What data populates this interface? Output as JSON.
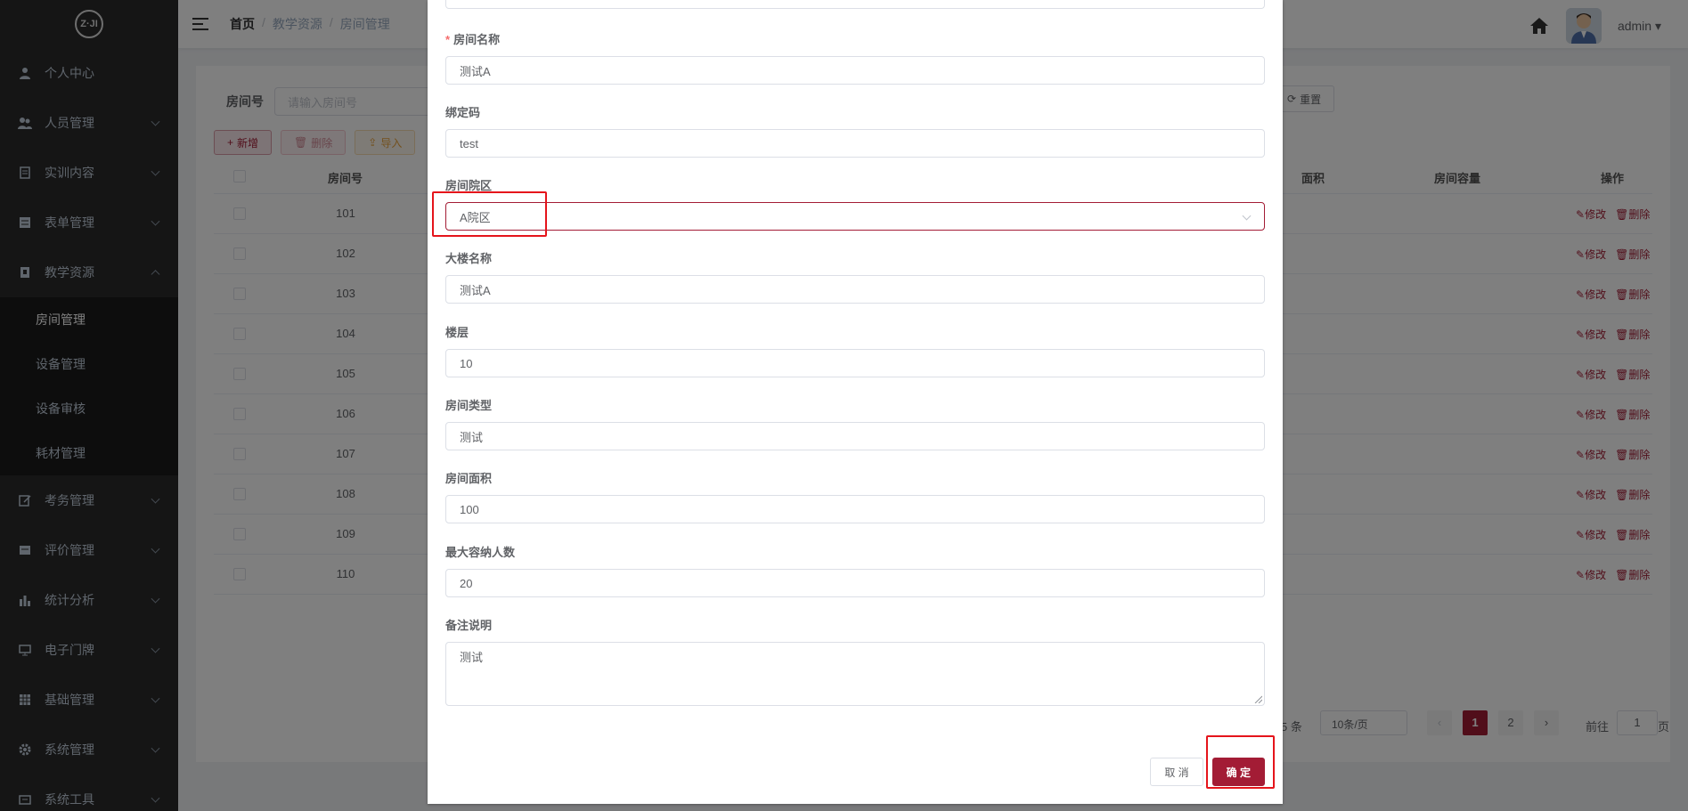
{
  "sidebar": {
    "logo_text": "Z·JI",
    "items": [
      {
        "label": "个人中心",
        "icon": "user-icon"
      },
      {
        "label": "人员管理",
        "icon": "people-icon"
      },
      {
        "label": "实训内容",
        "icon": "doc-icon"
      },
      {
        "label": "表单管理",
        "icon": "form-icon"
      },
      {
        "label": "教学资源",
        "icon": "book-icon"
      }
    ],
    "submenu": [
      {
        "label": "房间管理",
        "active": true
      },
      {
        "label": "设备管理"
      },
      {
        "label": "设备审核"
      },
      {
        "label": "耗材管理"
      }
    ],
    "items_after": [
      {
        "label": "考务管理",
        "icon": "edit-icon"
      },
      {
        "label": "评价管理",
        "icon": "rating-icon"
      },
      {
        "label": "统计分析",
        "icon": "chart-icon"
      },
      {
        "label": "电子门牌",
        "icon": "monitor-icon"
      },
      {
        "label": "基础管理",
        "icon": "grid-icon"
      },
      {
        "label": "系统管理",
        "icon": "gear-icon"
      },
      {
        "label": "系统工具",
        "icon": "tool-icon"
      }
    ]
  },
  "header": {
    "breadcrumb": [
      "首页",
      "教学资源",
      "房间管理"
    ],
    "user": "admin"
  },
  "page": {
    "search_label": "房间号",
    "search_placeholder": "请输入房间号",
    "reset_label": "重置",
    "add_label": "新增",
    "delete_label": "删除",
    "import_label": "导入",
    "columns": {
      "room_no": "房间号",
      "area": "面积",
      "capacity": "房间容量",
      "ops": "操作"
    },
    "rows": [
      "101",
      "102",
      "103",
      "104",
      "105",
      "106",
      "107",
      "108",
      "109",
      "110"
    ],
    "edit_label": "修改",
    "row_delete_label": "删除",
    "total": "5 条",
    "page_size": "10条/页",
    "pages": [
      "1",
      "2"
    ],
    "goto_label": "前往",
    "goto_value": "1",
    "page_suffix": "页"
  },
  "dialog": {
    "fields": {
      "room_name": {
        "label": "房间名称",
        "value": "测试A"
      },
      "bind_code": {
        "label": "绑定码",
        "value": "test"
      },
      "campus": {
        "label": "房间院区",
        "value": "A院区"
      },
      "building": {
        "label": "大楼名称",
        "value": "测试A"
      },
      "floor": {
        "label": "楼层",
        "value": "10"
      },
      "room_type": {
        "label": "房间类型",
        "value": "测试"
      },
      "room_area": {
        "label": "房间面积",
        "value": "100"
      },
      "max_capacity": {
        "label": "最大容纳人数",
        "value": "20"
      },
      "remark": {
        "label": "备注说明",
        "value": "测试"
      }
    },
    "cancel_label": "取 消",
    "confirm_label": "确 定"
  },
  "colors": {
    "accent": "#a31c35",
    "highlight": "#e5141b"
  }
}
